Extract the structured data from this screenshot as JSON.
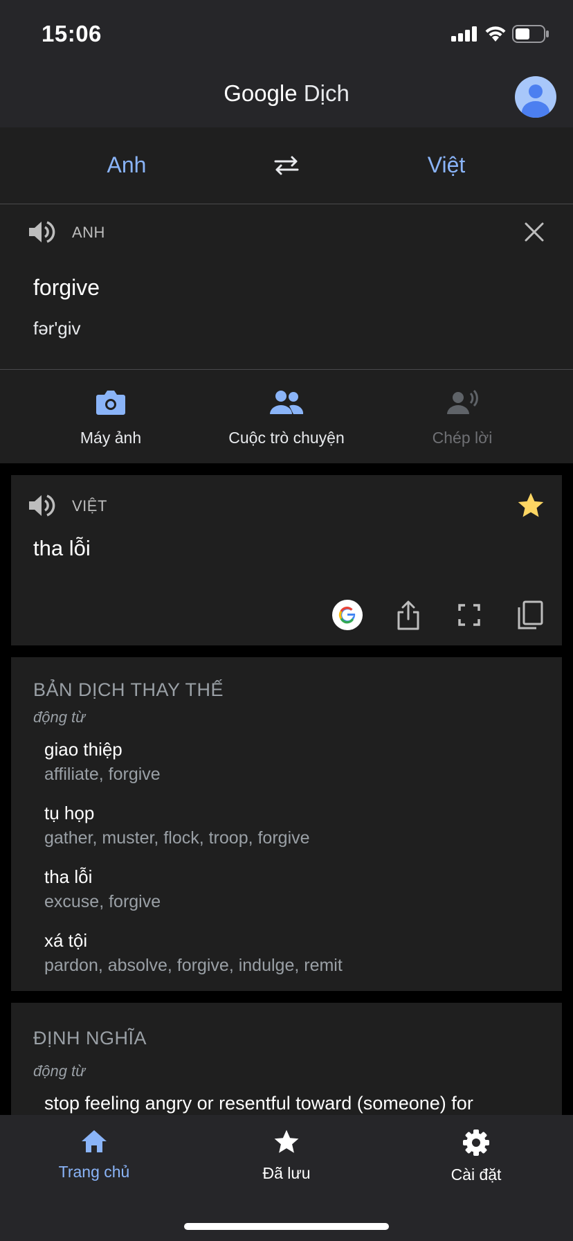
{
  "status_bar": {
    "time": "15:06"
  },
  "header": {
    "title_google": "Google",
    "title_dich": "Dịch"
  },
  "languages": {
    "source": "Anh",
    "target": "Việt"
  },
  "input": {
    "lang_label": "ANH",
    "text": "forgive",
    "phonetic": "fər'giv"
  },
  "tools": [
    {
      "label": "Máy ảnh",
      "icon": "camera-icon"
    },
    {
      "label": "Cuộc trò chuyện",
      "icon": "conversation-icon"
    },
    {
      "label": "Chép lời",
      "icon": "transcribe-icon"
    }
  ],
  "result": {
    "lang_label": "VIỆT",
    "text": "tha lỗi"
  },
  "alternatives": {
    "title": "BẢN DỊCH THAY THẾ",
    "pos": "động từ",
    "items": [
      {
        "word": "giao thiệp",
        "synonyms": "affiliate, forgive"
      },
      {
        "word": "tụ họp",
        "synonyms": "gather, muster, flock, troop, forgive"
      },
      {
        "word": "tha lỗi",
        "synonyms": "excuse, forgive"
      },
      {
        "word": "xá tội",
        "synonyms": "pardon, absolve, forgive, indulge, remit"
      }
    ]
  },
  "definitions": {
    "title": "ĐỊNH NGHĨA",
    "pos": "động từ",
    "text": "stop feeling angry or resentful toward (someone) for"
  },
  "bottom_nav": [
    {
      "label": "Trang chủ",
      "icon": "home-icon",
      "active": true
    },
    {
      "label": "Đã lưu",
      "icon": "star-icon",
      "active": false
    },
    {
      "label": "Cài đặt",
      "icon": "gear-icon",
      "active": false
    }
  ],
  "colors": {
    "accent": "#8ab4f8",
    "star": "#fdd663",
    "panel": "#1f1f1f",
    "bar": "#262629"
  }
}
